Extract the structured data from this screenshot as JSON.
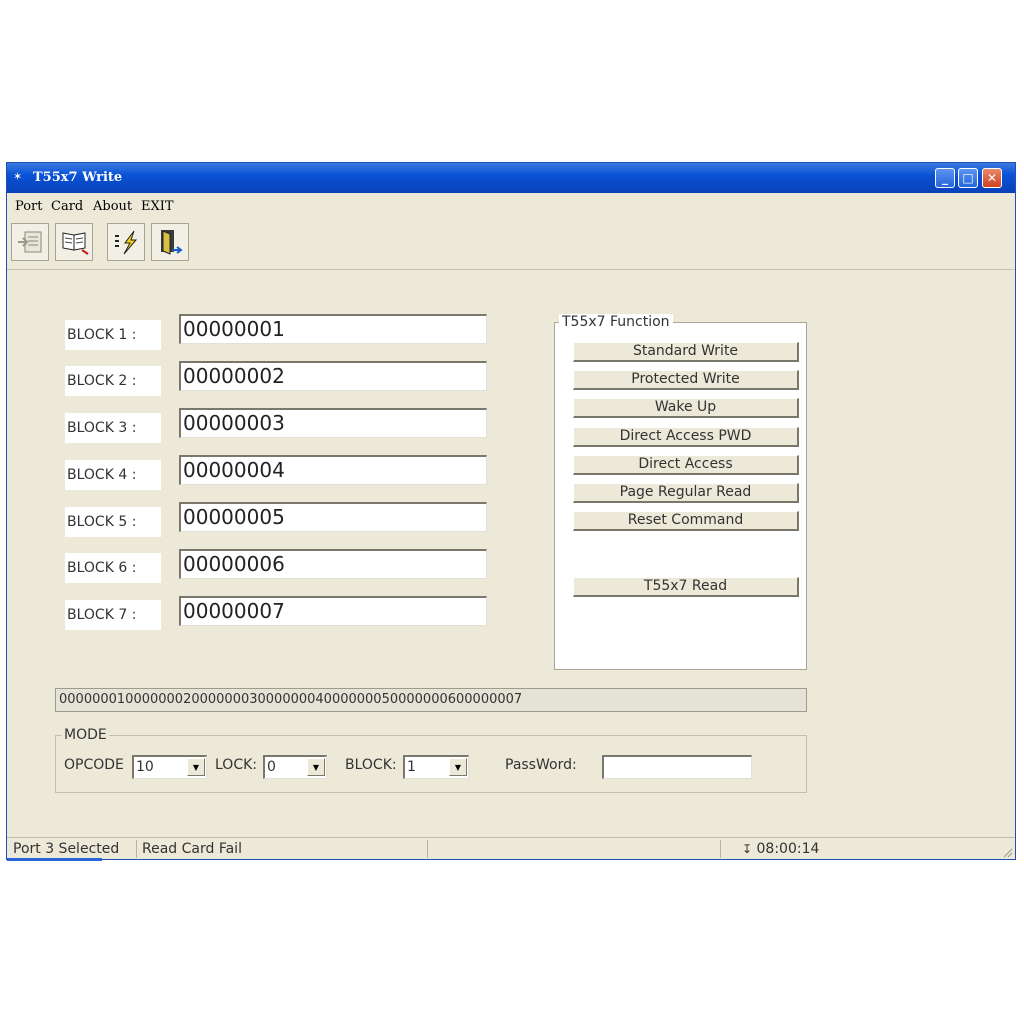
{
  "window": {
    "title": "T55x7 Write"
  },
  "menu": {
    "items": [
      "Port",
      "Card",
      "About",
      "EXIT"
    ]
  },
  "toolbar": {
    "icons": [
      "connect-icon",
      "read-book-icon",
      "write-lightning-icon",
      "exit-door-icon"
    ]
  },
  "blocks": [
    {
      "label": "BLOCK 1 :",
      "value": "00000001"
    },
    {
      "label": "BLOCK 2 :",
      "value": "00000002"
    },
    {
      "label": "BLOCK 3 :",
      "value": "00000003"
    },
    {
      "label": "BLOCK 4 :",
      "value": "00000004"
    },
    {
      "label": "BLOCK 5 :",
      "value": "00000005"
    },
    {
      "label": "BLOCK 6 :",
      "value": "00000006"
    },
    {
      "label": "BLOCK 7 :",
      "value": "00000007"
    }
  ],
  "functions": {
    "title": "T55x7 Function",
    "buttons": [
      "Standard  Write",
      "Protected  Write",
      "Wake  Up",
      "Direct  Access  PWD",
      "Direct  Access",
      "Page  Regular  Read",
      "Reset  Command"
    ],
    "read_button": "T55x7  Read"
  },
  "combined": "00000001000000020000000300000004000000050000000600000007",
  "mode": {
    "title": "MODE",
    "opcode_label": "OPCODE",
    "opcode_value": "10",
    "lock_label": "LOCK:",
    "lock_value": "0",
    "block_label": "BLOCK:",
    "block_value": "1",
    "password_label": "PassWord:",
    "password_value": ""
  },
  "status": {
    "port": "Port 3 Selected",
    "message": "Read Card Fail",
    "extra": "",
    "time": "08:00:14"
  }
}
